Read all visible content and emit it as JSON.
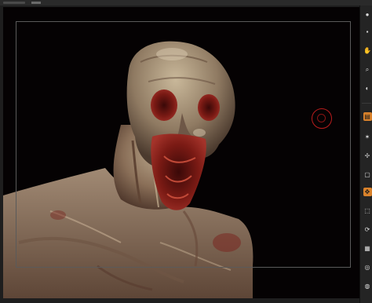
{
  "app": {
    "accent_color": "#d9822b",
    "background_color": "#050203"
  },
  "canvas": {
    "subject": "sculpted creature bust",
    "brush_cursor_color": "#b81c1c"
  },
  "right_shelf": {
    "buttons": [
      {
        "id": "bpr",
        "icon": "sphere-icon",
        "label": "",
        "active": false
      },
      {
        "id": "spix",
        "icon": "pixel-icon",
        "label": "",
        "active": false
      },
      {
        "id": "scroll",
        "icon": "hand-icon",
        "label": "",
        "active": false
      },
      {
        "id": "zoom",
        "icon": "magnify-icon",
        "label": "",
        "active": false
      },
      {
        "id": "actual",
        "icon": "actual-icon",
        "label": "",
        "active": false
      },
      {
        "id": "floor",
        "icon": "floor-icon",
        "label": "",
        "active": true
      },
      {
        "id": "local",
        "icon": "local-icon",
        "label": "",
        "active": false
      },
      {
        "id": "xyz",
        "icon": "xyz-icon",
        "label": "",
        "active": false
      },
      {
        "id": "frame",
        "icon": "frame-icon",
        "label": "",
        "active": false
      },
      {
        "id": "move",
        "icon": "move-icon",
        "label": "",
        "active": true
      },
      {
        "id": "scale",
        "icon": "scale-icon",
        "label": "",
        "active": false
      },
      {
        "id": "rotate",
        "icon": "rotate-icon",
        "label": "",
        "active": false
      },
      {
        "id": "linefill",
        "icon": "linefill-icon",
        "label": "",
        "active": false
      },
      {
        "id": "transp",
        "icon": "transp-icon",
        "label": "",
        "active": false
      }
    ]
  }
}
